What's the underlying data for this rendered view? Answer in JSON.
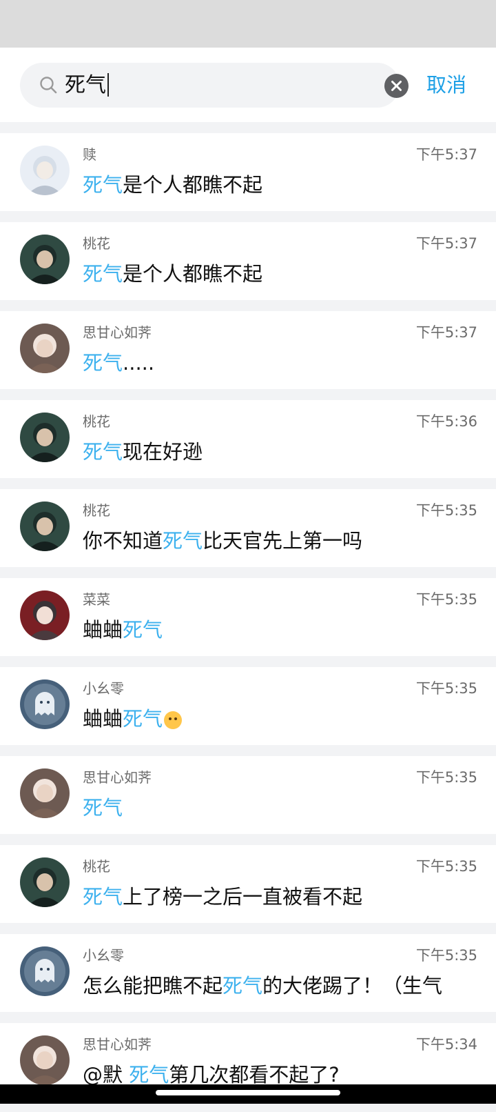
{
  "search": {
    "query": "死气",
    "cancel_label": "取消"
  },
  "colors": {
    "accent": "#1ea0e6",
    "highlight": "#3db1ee",
    "header_bg": "#dcdcdc",
    "list_bg": "#f2f3f5"
  },
  "results": [
    {
      "name": "赎",
      "time": "下午5:37",
      "avatar": "anime-boy-light",
      "parts": [
        {
          "t": "死气",
          "h": true
        },
        {
          "t": "是个人都瞧不起",
          "h": false
        }
      ]
    },
    {
      "name": "桃花",
      "time": "下午5:37",
      "avatar": "dark-hair-boy",
      "parts": [
        {
          "t": "死气",
          "h": true
        },
        {
          "t": "是个人都瞧不起",
          "h": false
        }
      ]
    },
    {
      "name": "思甘心如荠",
      "time": "下午5:37",
      "avatar": "anime-girl-brown",
      "parts": [
        {
          "t": "死气",
          "h": true
        },
        {
          "t": ".....",
          "h": false
        }
      ]
    },
    {
      "name": "桃花",
      "time": "下午5:36",
      "avatar": "dark-hair-boy",
      "parts": [
        {
          "t": "死气",
          "h": true
        },
        {
          "t": "现在好逊",
          "h": false
        }
      ]
    },
    {
      "name": "桃花",
      "time": "下午5:35",
      "avatar": "dark-hair-boy",
      "parts": [
        {
          "t": "你不知道",
          "h": false
        },
        {
          "t": "死气",
          "h": true
        },
        {
          "t": "比天官先上第一吗",
          "h": false
        }
      ]
    },
    {
      "name": "菜菜",
      "time": "下午5:35",
      "avatar": "anime-girl-red",
      "parts": [
        {
          "t": "蛐蛐",
          "h": false
        },
        {
          "t": "死气",
          "h": true
        }
      ]
    },
    {
      "name": "小幺零",
      "time": "下午5:35",
      "avatar": "ghost",
      "parts": [
        {
          "t": "蛐蛐",
          "h": false
        },
        {
          "t": "死气",
          "h": true
        }
      ],
      "emoji": "smiling-dog-emoji"
    },
    {
      "name": "思甘心如荠",
      "time": "下午5:35",
      "avatar": "anime-girl-brown",
      "parts": [
        {
          "t": "死气",
          "h": true
        }
      ]
    },
    {
      "name": "桃花",
      "time": "下午5:35",
      "avatar": "dark-hair-boy",
      "parts": [
        {
          "t": "死气",
          "h": true
        },
        {
          "t": "上了榜一之后一直被看不起",
          "h": false
        }
      ]
    },
    {
      "name": "小幺零",
      "time": "下午5:35",
      "avatar": "ghost",
      "parts": [
        {
          "t": "怎么能把瞧不起",
          "h": false
        },
        {
          "t": "死气",
          "h": true
        },
        {
          "t": "的大佬踢了！（生气",
          "h": false
        }
      ]
    },
    {
      "name": "思甘心如荠",
      "time": "下午5:34",
      "avatar": "anime-girl-brown",
      "parts": [
        {
          "t": "@默 ",
          "h": false
        },
        {
          "t": "死气",
          "h": true
        },
        {
          "t": "第几次都看不起了?",
          "h": false
        }
      ]
    }
  ]
}
